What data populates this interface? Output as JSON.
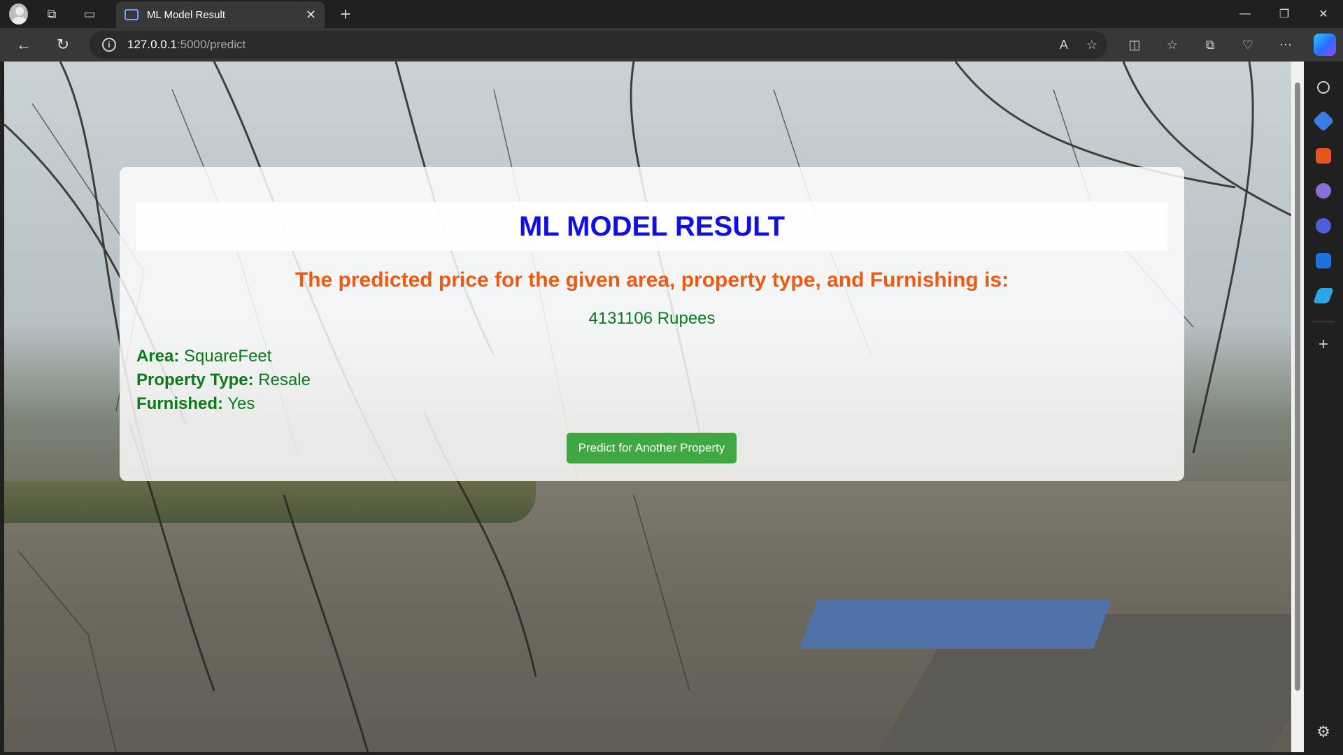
{
  "browser": {
    "tab_title": "ML Model Result",
    "url_host": "127.0.0.1",
    "url_path": ":5000/predict"
  },
  "page": {
    "heading": "ML MODEL RESULT",
    "subtitle": "The predicted price for the given area, property type, and Furnishing is:",
    "price": "4131106 Rupees",
    "details": [
      {
        "label": "Area:",
        "value": "SquareFeet"
      },
      {
        "label": "Property Type:",
        "value": "Resale"
      },
      {
        "label": "Furnished:",
        "value": "Yes"
      }
    ],
    "button_label": "Predict for Another Property"
  },
  "colors": {
    "heading": "#1010e0",
    "subtitle": "#f05a10",
    "text": "#0a7a1a",
    "button": "#3fa843"
  },
  "icons": [
    "profile-icon",
    "workspaces-icon",
    "tab-actions-icon",
    "close-icon",
    "new-tab-icon",
    "back-icon",
    "refresh-icon",
    "info-icon",
    "read-aloud-icon",
    "favorite-icon",
    "split-screen-icon",
    "favorites-icon",
    "collections-icon",
    "browser-essentials-icon",
    "more-icon",
    "copilot-icon",
    "search-icon",
    "shopping-icon",
    "tools-icon",
    "games-icon",
    "microsoft365-icon",
    "outlook-icon",
    "send-icon",
    "add-icon",
    "settings-icon"
  ]
}
